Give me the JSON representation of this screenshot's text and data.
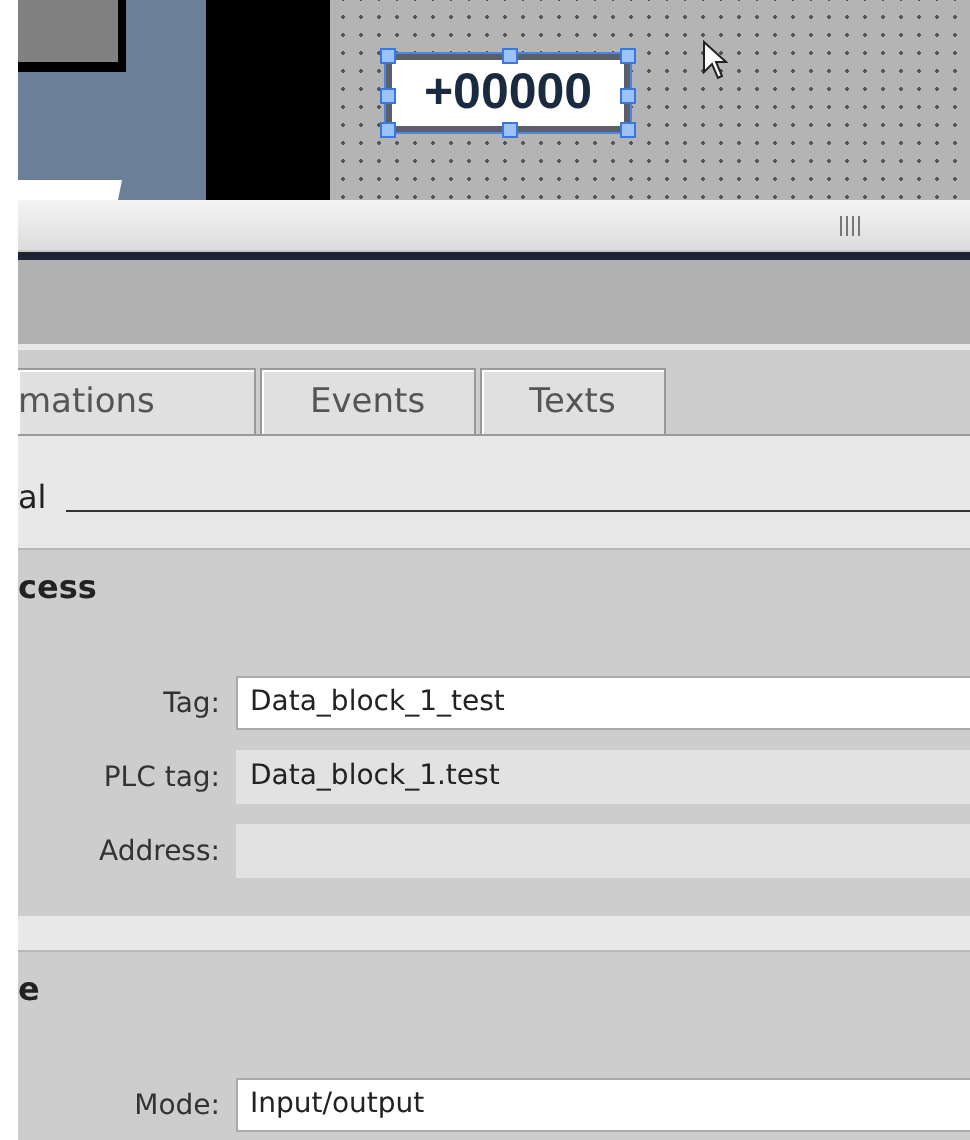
{
  "canvas": {
    "io_field": {
      "value": "+00000",
      "selected": true
    }
  },
  "tabs": [
    {
      "label": "mations"
    },
    {
      "label": "Events"
    },
    {
      "label": "Texts"
    }
  ],
  "group_title": "al",
  "sections": [
    {
      "title": "cess",
      "fields": [
        {
          "label": "Tag:",
          "value": "Data_block_1_test",
          "readonly": false
        },
        {
          "label": "PLC tag:",
          "value": "Data_block_1.test",
          "readonly": true
        },
        {
          "label": "Address:",
          "readonly": true
        }
      ]
    },
    {
      "title": "e",
      "fields": [
        {
          "label": "Mode:",
          "value": "Input/output",
          "readonly": false
        }
      ]
    }
  ]
}
